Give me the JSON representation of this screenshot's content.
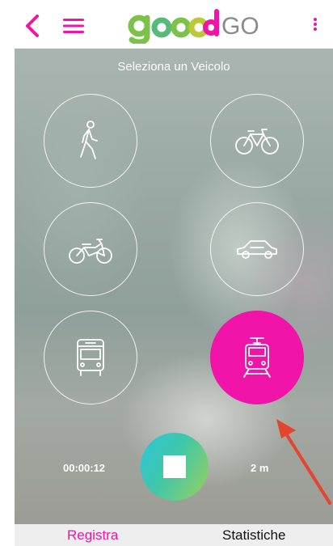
{
  "colors": {
    "accent": "#f014a8",
    "logo_green": "#7cc24a",
    "logo_pink": "#f014a8"
  },
  "header": {
    "back_icon": "chevron-left-icon",
    "menu_icon": "hamburger-menu-icon",
    "logo_main": "goood",
    "logo_suffix": "GO",
    "more_icon": "kebab-menu-icon"
  },
  "main": {
    "title": "Seleziona un Veicolo",
    "vehicles": [
      {
        "name": "walk",
        "icon": "walking-icon",
        "selected": false
      },
      {
        "name": "bicycle",
        "icon": "bicycle-icon",
        "selected": false
      },
      {
        "name": "motorbike",
        "icon": "motorbike-icon",
        "selected": false
      },
      {
        "name": "car",
        "icon": "car-icon",
        "selected": false
      },
      {
        "name": "bus",
        "icon": "bus-icon",
        "selected": false
      },
      {
        "name": "tram",
        "icon": "tram-icon",
        "selected": true
      }
    ],
    "timer": "00:00:12",
    "distance": "2 m",
    "stop_icon": "stop-icon"
  },
  "tabs": [
    {
      "label": "Registra",
      "active": true
    },
    {
      "label": "Statistiche",
      "active": false
    }
  ]
}
